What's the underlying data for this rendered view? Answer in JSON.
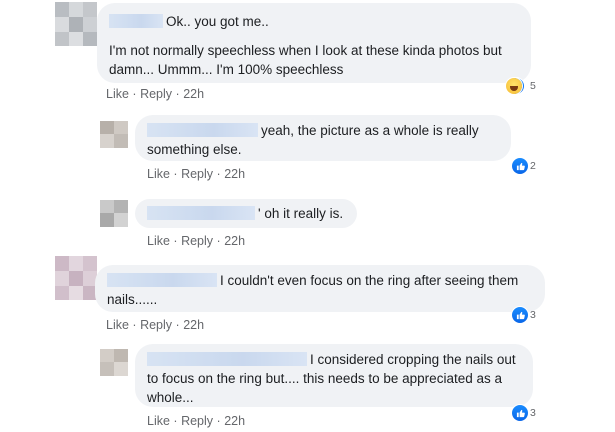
{
  "colors": {
    "bubble_bg": "#f0f2f5",
    "meta_text": "#65676b",
    "like_blue": "#1877f2",
    "name_blur": "#d0ddf1"
  },
  "comments": [
    {
      "lines": [
        "Ok.. you got me..",
        "",
        "I'm not normally speechless when I look at these kinda photos but",
        "damn... Ummm... I'm 100% speechless"
      ],
      "like": "Like",
      "reply": "Reply",
      "time": "22h",
      "reaction_icons": [
        "like-icon",
        "haha-icon"
      ],
      "reaction_count": "5"
    },
    {
      "lines": [
        "yeah, the picture as a whole is really",
        "something else."
      ],
      "like": "Like",
      "reply": "Reply",
      "time": "22h",
      "reaction_icons": [
        "like-icon"
      ],
      "reaction_count": "2"
    },
    {
      "lines": [
        "' oh it really is."
      ],
      "like": "Like",
      "reply": "Reply",
      "time": "22h"
    },
    {
      "lines": [
        "I couldn't even focus on the ring after seeing them",
        "nails......"
      ],
      "like": "Like",
      "reply": "Reply",
      "time": "22h",
      "reaction_icons": [
        "like-icon"
      ],
      "reaction_count": "3"
    },
    {
      "lines": [
        "I considered cropping the nails out",
        "to focus on the ring but.... this needs to be appreciated as a",
        "whole..."
      ],
      "like": "Like",
      "reply": "Reply",
      "time": "22h",
      "reaction_icons": [
        "like-icon"
      ],
      "reaction_count": "3"
    }
  ],
  "separators": {
    "dot": "·"
  }
}
